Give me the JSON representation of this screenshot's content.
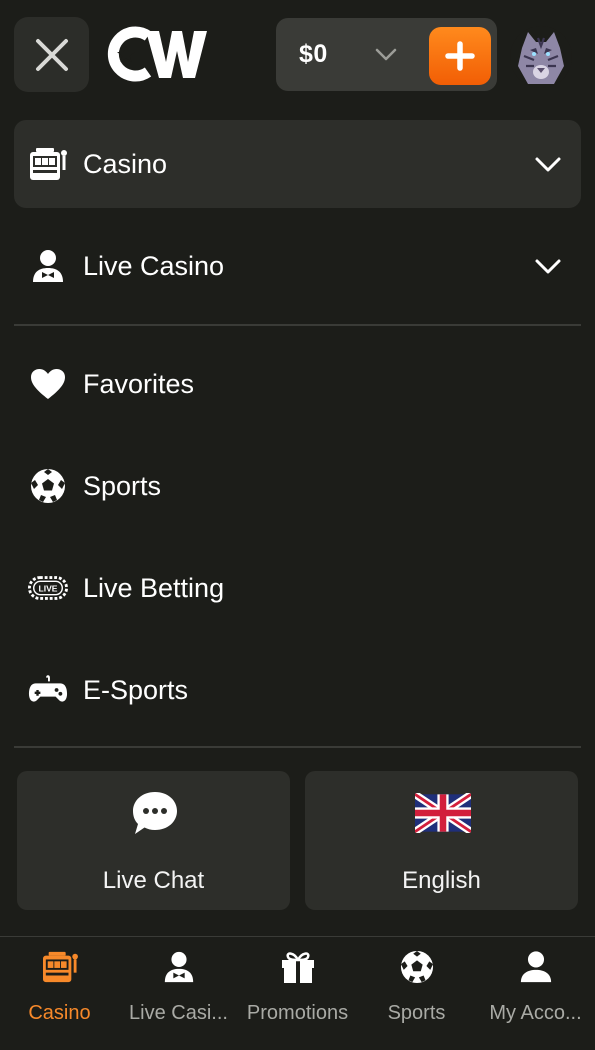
{
  "header": {
    "balance": "$0",
    "logo_text": "CW"
  },
  "menu": {
    "casino": "Casino",
    "live_casino": "Live Casino",
    "favorites": "Favorites",
    "sports": "Sports",
    "live_betting": "Live Betting",
    "live_badge": "LIVE",
    "esports": "E-Sports"
  },
  "cards": {
    "live_chat": "Live Chat",
    "language": "English"
  },
  "bottom_nav": {
    "items": [
      {
        "label": "Casino",
        "icon": "slot-machine-icon",
        "active": true
      },
      {
        "label": "Live Casi...",
        "icon": "dealer-icon",
        "active": false
      },
      {
        "label": "Promotions",
        "icon": "gift-icon",
        "active": false
      },
      {
        "label": "Sports",
        "icon": "soccer-ball-icon",
        "active": false
      },
      {
        "label": "My Acco...",
        "icon": "user-icon",
        "active": false
      }
    ]
  },
  "colors": {
    "background": "#1c1d19",
    "surface": "#2d2e2a",
    "accent": "#f7892a",
    "deposit_gradient_top": "#ff8a1d",
    "deposit_gradient_bottom": "#f25e05"
  }
}
